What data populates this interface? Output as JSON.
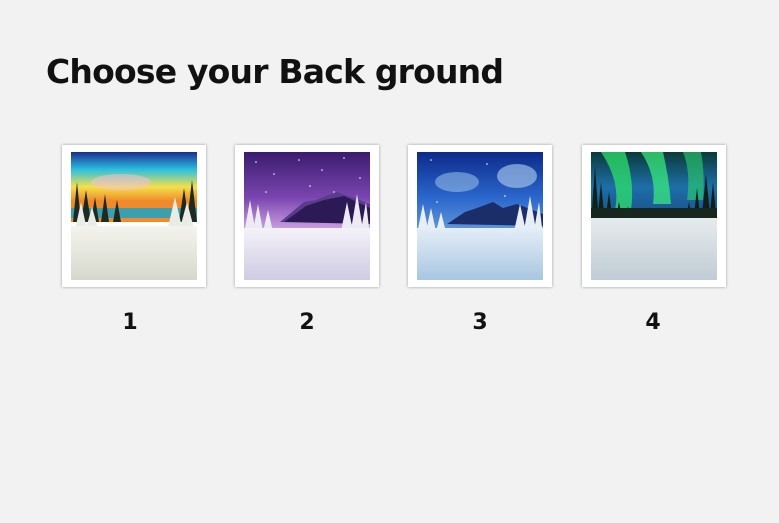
{
  "header": {
    "title": "Choose your Back ground"
  },
  "options": [
    {
      "label": "1",
      "thumbnail": "sunset-winter-forest-scene",
      "sky_colors": [
        "#1e2a8c",
        "#27c8e0",
        "#f3d83a",
        "#f08a2a"
      ]
    },
    {
      "label": "2",
      "thumbnail": "purple-starry-night-mountain-scene",
      "sky_colors": [
        "#3a1c6e",
        "#8b4fb8",
        "#c79bd8"
      ]
    },
    {
      "label": "3",
      "thumbnail": "blue-night-sky-mountain-scene",
      "sky_colors": [
        "#0c2a8a",
        "#2f6ed4",
        "#8fbde6"
      ]
    },
    {
      "label": "4",
      "thumbnail": "northern-lights-forest-scene",
      "sky_colors": [
        "#0b3a2a",
        "#2ee06b",
        "#1a6fb0"
      ]
    }
  ]
}
